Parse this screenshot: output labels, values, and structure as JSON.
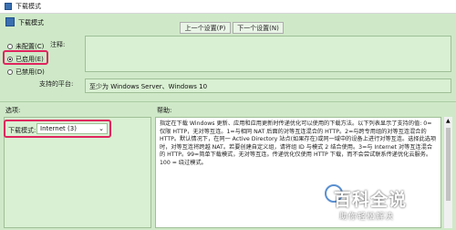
{
  "window": {
    "title": "下载模式",
    "header_title": "下载模式"
  },
  "nav": {
    "prev_label": "上一个设置(P)",
    "next_label": "下一个设置(N)"
  },
  "state": {
    "options": [
      {
        "label": "未配置(C)",
        "selected": false
      },
      {
        "label": "已启用(E)",
        "selected": true
      },
      {
        "label": "已禁用(D)",
        "selected": false
      }
    ]
  },
  "comment": {
    "label": "注释:",
    "value": ""
  },
  "supported": {
    "label": "支持的平台:",
    "value": "至少为 Windows Server、Windows 10"
  },
  "sections": {
    "options_label": "选项:",
    "help_label": "帮助:"
  },
  "option": {
    "label": "下载模式:",
    "selected": "Internet (3)"
  },
  "help": {
    "text": "指定在下载 Windows 更新、应用和应用更新时传递优化可以使用的下载方法。以下列表显示了支持的值: 0=仅限 HTTP，无对等互连。1=与相同 NAT 后面的对等互连混合的 HTTP。2=与跨专用组的对等互连混合的 HTTP。默认情况下，在同一 Active Directory 站点(如果存在)或同一域中的设备上进行对等互连。选择此选项时，对等互连将跨越 NAT。若要创建自定义组，请将组 ID 与模式 2 结合使用。3=与 Internet 对等互连混合的 HTTP。99=简单下载模式，无对等互连。传递优化仅使用 HTTP 下载，而不会尝试联系传递优化云服务。100 = 绕过模式。"
  },
  "watermark": {
    "big": "百科全说",
    "small": "助你轻松解决"
  },
  "colors": {
    "highlight": "#e0245e",
    "pane_green": "#d9f0d2"
  }
}
